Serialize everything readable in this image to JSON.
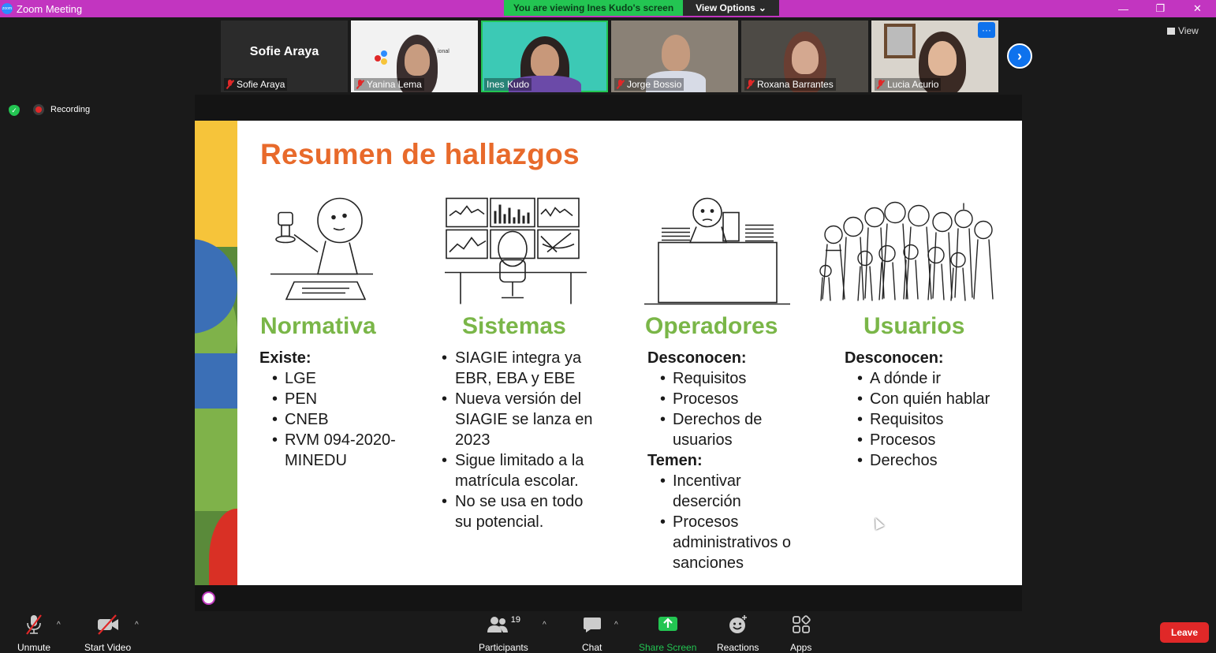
{
  "window": {
    "title": "Zoom Meeting",
    "banner": "You are viewing Ines Kudo's screen",
    "view_options": "View Options",
    "view_options_caret": "⌄",
    "controls": [
      "—",
      "❐",
      "✕"
    ]
  },
  "view_button": "View",
  "participants_strip": [
    {
      "name": "Sofie Araya",
      "display_name": "Sofie Araya",
      "video": false
    },
    {
      "name": "Yanina Lema",
      "video": true,
      "bg": "#f1f1f1"
    },
    {
      "name": "Ines Kudo",
      "video": true,
      "bg": "#3cc9b5",
      "active": true
    },
    {
      "name": "Jorge Bossio",
      "video": true,
      "bg": "#8a8176"
    },
    {
      "name": "Roxana Barrantes",
      "video": true,
      "bg": "#4d4a45"
    },
    {
      "name": "Lucia Acurio",
      "video": true,
      "bg": "#d9d4cc"
    }
  ],
  "thumb_more": "···",
  "next_arrow": "›",
  "recording": {
    "label": "Recording",
    "security_check": "✓"
  },
  "slide": {
    "title": "Resumen de hallazgos",
    "yanina_logo_text": "ional",
    "columns": [
      {
        "heading": "Normativa",
        "sections": [
          {
            "sub": "Existe:",
            "items": [
              "LGE",
              "PEN",
              "CNEB",
              "RVM 094-2020-MINEDU"
            ]
          }
        ]
      },
      {
        "heading": "Sistemas",
        "sections": [
          {
            "sub": "",
            "items": [
              "SIAGIE integra ya EBR, EBA y EBE",
              "Nueva versión  del SIAGIE se lanza en 2023",
              "Sigue limitado a la matrícula escolar.",
              "No se usa en todo su potencial."
            ]
          }
        ]
      },
      {
        "heading": "Operadores",
        "sections": [
          {
            "sub": "Desconocen:",
            "items": [
              "Requisitos",
              "Procesos",
              "Derechos de usuarios"
            ]
          },
          {
            "sub": "Temen:",
            "items": [
              "Incentivar deserción",
              "Procesos administrativos o sanciones"
            ]
          }
        ]
      },
      {
        "heading": "Usuarios",
        "sections": [
          {
            "sub": "Desconocen:",
            "items": [
              "A dónde ir",
              "Con quién hablar",
              "Requisitos",
              "Procesos",
              "Derechos"
            ]
          }
        ]
      }
    ]
  },
  "toolbar": {
    "unmute": "Unmute",
    "start_video": "Start Video",
    "participants": "Participants",
    "participants_count": "19",
    "chat": "Chat",
    "share_screen": "Share Screen",
    "reactions": "Reactions",
    "apps": "Apps",
    "leave": "Leave",
    "caret": "^"
  },
  "colors": {
    "titlebar": "#c235c0",
    "banner": "#23c552",
    "slide_title": "#e86a2b",
    "slide_heading": "#7ab648",
    "leave": "#e02828",
    "share_icon": "#23c552"
  }
}
